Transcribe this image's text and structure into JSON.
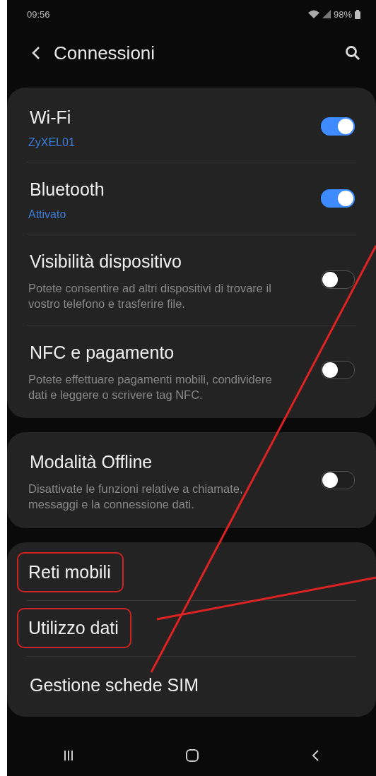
{
  "status_bar": {
    "time": "09:56",
    "battery": "98%"
  },
  "header": {
    "title": "Connessioni"
  },
  "groups": [
    {
      "items": [
        {
          "kind": "toggle",
          "title": "Wi-Fi",
          "subtitle": "ZyXEL01",
          "on": true,
          "highlighted": false
        },
        {
          "kind": "toggle",
          "title": "Bluetooth",
          "subtitle": "Attivato",
          "on": true,
          "highlighted": false
        },
        {
          "kind": "toggle",
          "title": "Visibilità dispositivo",
          "description": "Potete consentire ad altri dispositivi di trovare il vostro telefono e trasferire file.",
          "on": false,
          "highlighted": false
        },
        {
          "kind": "toggle",
          "title": "NFC e pagamento",
          "description": "Potete effettuare pagamenti mobili, condividere dati e leggere o scrivere tag NFC.",
          "on": false,
          "highlighted": false
        }
      ]
    },
    {
      "items": [
        {
          "kind": "toggle",
          "title": "Modalità Offline",
          "description": "Disattivate le funzioni relative a chiamate, messaggi e la connessione dati.",
          "on": false,
          "highlighted": false
        }
      ]
    },
    {
      "items": [
        {
          "kind": "link",
          "title": "Reti mobili",
          "highlighted": true
        },
        {
          "kind": "link",
          "title": "Utilizzo dati",
          "highlighted": true
        },
        {
          "kind": "link",
          "title": "Gestione schede SIM",
          "highlighted": false
        }
      ]
    }
  ]
}
